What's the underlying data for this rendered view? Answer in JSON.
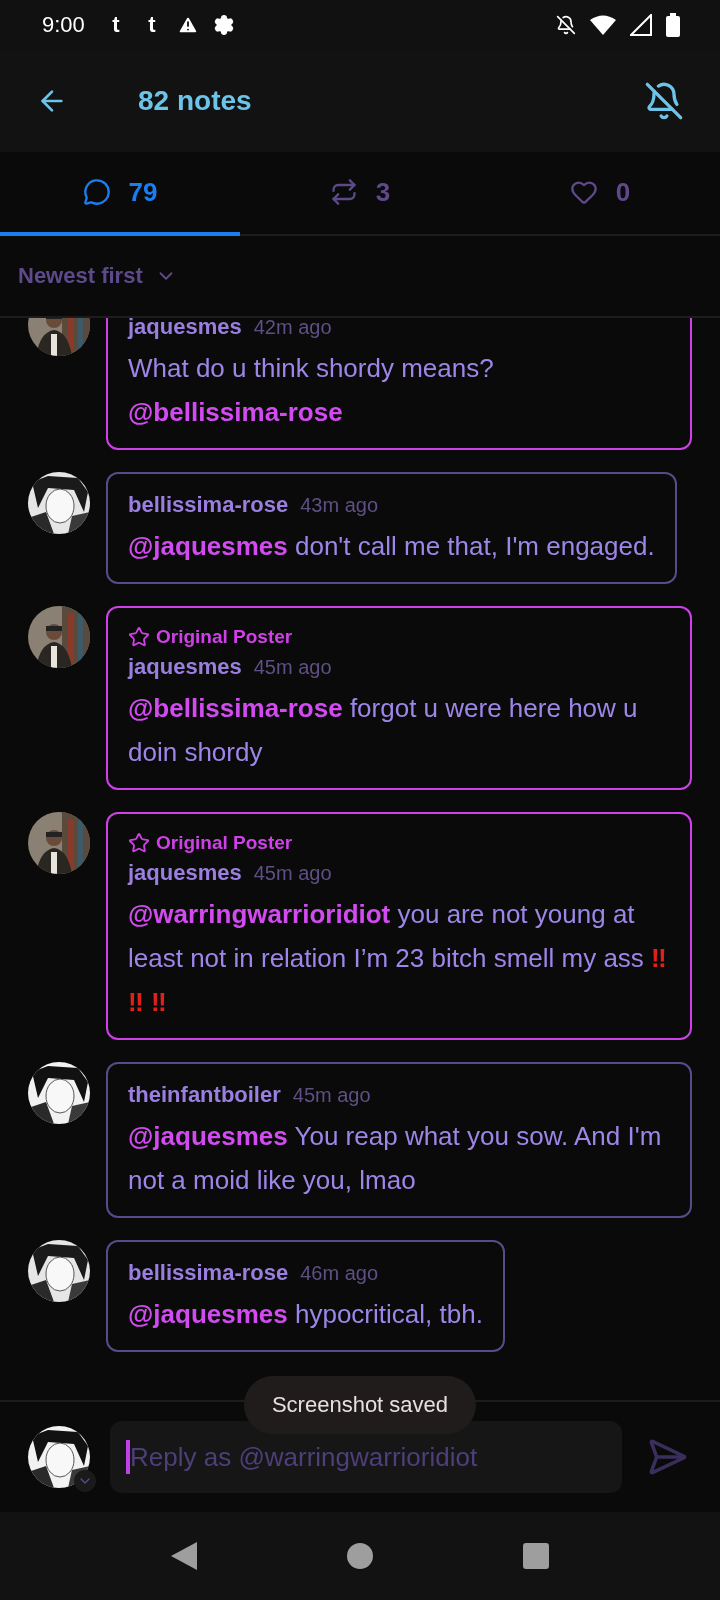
{
  "status_bar": {
    "time": "9:00",
    "notification_icons": [
      "t",
      "t"
    ]
  },
  "header": {
    "title": "82 notes"
  },
  "tabs": [
    {
      "kind": "replies",
      "count": "79",
      "selected": true
    },
    {
      "kind": "reblogs",
      "count": "3",
      "selected": false
    },
    {
      "kind": "likes",
      "count": "0",
      "selected": false
    }
  ],
  "sort": {
    "label": "Newest first"
  },
  "comments": [
    {
      "original_poster": true,
      "author": "jaquesmes",
      "time": "42m ago",
      "body": [
        {
          "kind": "text",
          "text": "What do u think shordy means? "
        },
        {
          "kind": "mention",
          "text": "@bellissima-rose"
        }
      ]
    },
    {
      "original_poster": false,
      "author": "bellissima-rose",
      "time": "43m ago",
      "body": [
        {
          "kind": "mention",
          "text": "@jaquesmes"
        },
        {
          "kind": "text",
          "text": " don't call me that, I'm engaged."
        }
      ]
    },
    {
      "original_poster": true,
      "badge": "Original Poster",
      "author": "jaquesmes",
      "time": "45m ago",
      "body": [
        {
          "kind": "mention",
          "text": "@bellissima-rose"
        },
        {
          "kind": "text",
          "text": " forgot u were here how u doin shordy"
        }
      ]
    },
    {
      "original_poster": true,
      "badge": "Original Poster",
      "author": "jaquesmes",
      "time": "45m ago",
      "body": [
        {
          "kind": "mention",
          "text": "@warringwarrioridiot"
        },
        {
          "kind": "text",
          "text": " you are not young at least not in relation I’m 23 bitch smell my ass "
        },
        {
          "kind": "emoji",
          "text": "‼ ‼ ‼"
        }
      ]
    },
    {
      "original_poster": false,
      "author": "theinfantboiler",
      "time": "45m ago",
      "body": [
        {
          "kind": "mention",
          "text": "@jaquesmes"
        },
        {
          "kind": "text",
          "text": " You reap what you sow. And I'm not a moid like you, lmao"
        }
      ]
    },
    {
      "original_poster": false,
      "author": "bellissima-rose",
      "time": "46m ago",
      "body": [
        {
          "kind": "mention",
          "text": "@jaquesmes"
        },
        {
          "kind": "text",
          "text": " hypocritical, tbh."
        }
      ]
    }
  ],
  "toast": {
    "text": "Screenshot saved"
  },
  "composer": {
    "placeholder": "Reply as @warringwarrioridiot"
  }
}
